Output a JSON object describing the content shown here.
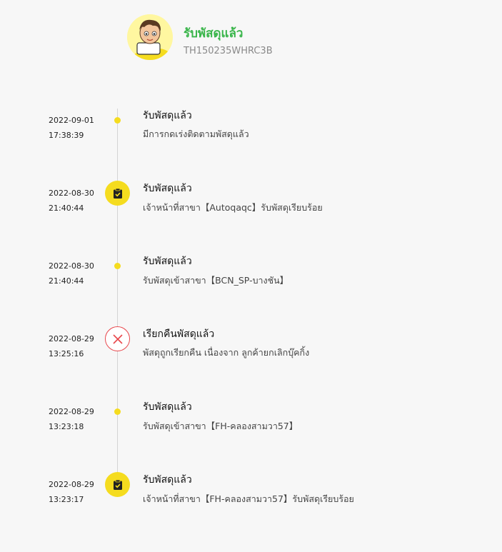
{
  "header": {
    "title": "รับพัสดุแล้ว",
    "tracking_number": "TH150235WHRC3B",
    "avatar_icon": "courier-mascot-icon",
    "accent_color": "#39b54a"
  },
  "events": [
    {
      "date": "2022-09-01",
      "time": "17:38:39",
      "title": "รับพัสดุแล้ว",
      "description": "มีการกดเร่งติดตามพัสดุแล้ว",
      "marker": "dot"
    },
    {
      "date": "2022-08-30",
      "time": "21:40:44",
      "title": "รับพัสดุแล้ว",
      "description": "เจ้าหน้าที่สาขา【Autoqaqc】รับพัสดุเรียบร้อย",
      "marker": "clipboard-check-icon"
    },
    {
      "date": "2022-08-30",
      "time": "21:40:44",
      "title": "รับพัสดุแล้ว",
      "description": "รับพัสดุเข้าสาขา【BCN_SP-บางชัน】",
      "marker": "dot"
    },
    {
      "date": "2022-08-29",
      "time": "13:25:16",
      "title": "เรียกคืนพัสดุแล้ว",
      "description": "พัสดุถูกเรียกคืน เนื่องจาก ลูกค้ายกเลิกบุ๊คกิ้ง",
      "marker": "cancel-x-icon"
    },
    {
      "date": "2022-08-29",
      "time": "13:23:18",
      "title": "รับพัสดุแล้ว",
      "description": "รับพัสดุเข้าสาขา【FH-คลองสามวา57】",
      "marker": "dot"
    },
    {
      "date": "2022-08-29",
      "time": "13:23:17",
      "title": "รับพัสดุแล้ว",
      "description": "เจ้าหน้าที่สาขา【FH-คลองสามวา57】รับพัสดุเรียบร้อย",
      "marker": "clipboard-check-icon"
    }
  ]
}
